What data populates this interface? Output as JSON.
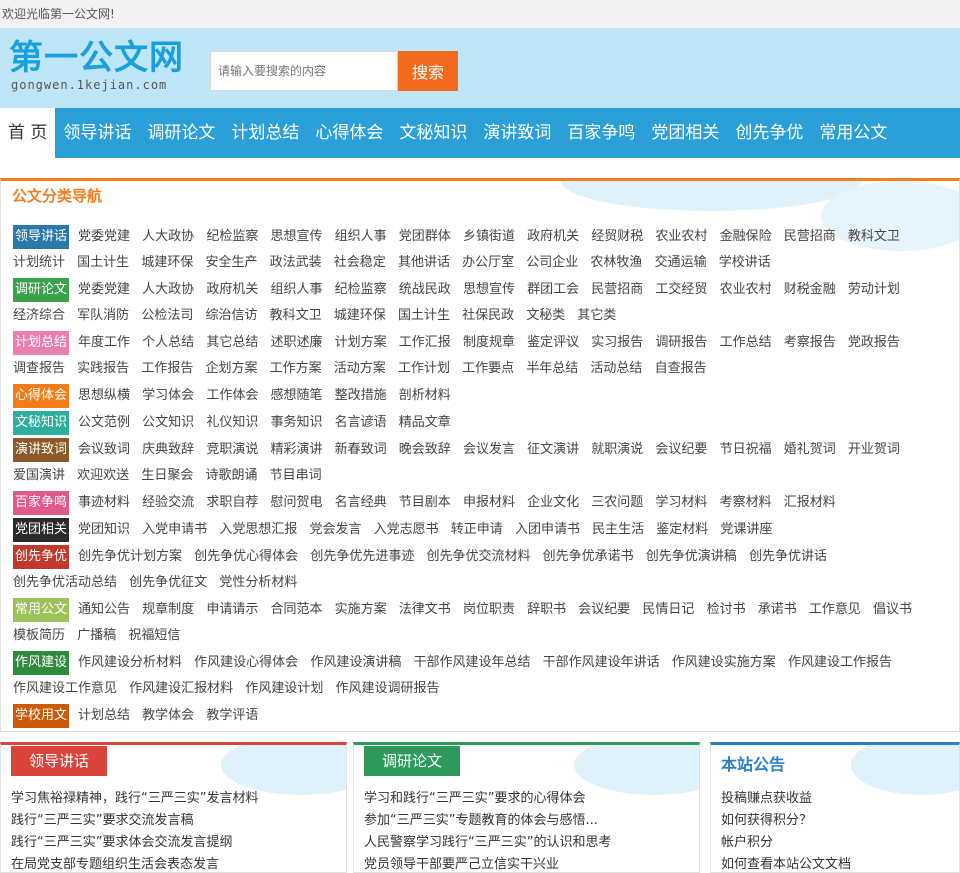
{
  "welcome": "欢迎光临第一公文网!",
  "logo": {
    "main": "第一公文网",
    "sub": "gongwen.1kejian.com"
  },
  "search": {
    "placeholder": "请输入要搜索的内容",
    "button": "搜索"
  },
  "nav": [
    "首 页",
    "领导讲话",
    "调研论文",
    "计划总结",
    "心得体会",
    "文秘知识",
    "演讲致词",
    "百家争鸣",
    "党团相关",
    "创先争优",
    "常用公文"
  ],
  "catnav": {
    "title": "公文分类导航",
    "rows": [
      {
        "tag": "领导讲话",
        "color": "#2a79a8",
        "links": [
          "党委党建",
          "人大政协",
          "纪检监察",
          "思想宣传",
          "组织人事",
          "党团群体",
          "乡镇街道",
          "政府机关",
          "经贸财税",
          "农业农村",
          "金融保险",
          "民营招商",
          "教科文卫",
          "计划统计",
          "国土计生",
          "城建环保",
          "安全生产",
          "政法武装",
          "社会稳定",
          "其他讲话",
          "办公厅室",
          "公司企业",
          "农林牧渔",
          "交通运输",
          "学校讲话"
        ]
      },
      {
        "tag": "调研论文",
        "color": "#3aa24a",
        "links": [
          "党委党建",
          "人大政协",
          "政府机关",
          "组织人事",
          "纪检监察",
          "统战民政",
          "思想宣传",
          "群团工会",
          "民营招商",
          "工交经贸",
          "农业农村",
          "财税金融",
          "劳动计划",
          "经济综合",
          "军队消防",
          "公检法司",
          "综治信访",
          "教科文卫",
          "城建环保",
          "国土计生",
          "社保民政",
          "文秘类",
          "其它类"
        ]
      },
      {
        "tag": "计划总结",
        "color": "#e87fb0",
        "links": [
          "年度工作",
          "个人总结",
          "其它总结",
          "述职述廉",
          "计划方案",
          "工作汇报",
          "制度规章",
          "鉴定评议",
          "实习报告",
          "调研报告",
          "工作总结",
          "考察报告",
          "党政报告",
          "调查报告",
          "实践报告",
          "工作报告",
          "企划方案",
          "工作方案",
          "活动方案",
          "工作计划",
          "工作要点",
          "半年总结",
          "活动总结",
          "自查报告"
        ]
      },
      {
        "tag": "心得体会",
        "color": "#f07d1a",
        "links": [
          "思想纵横",
          "学习体会",
          "工作体会",
          "感想随笔",
          "整改措施",
          "剖析材料"
        ]
      },
      {
        "tag": "文秘知识",
        "color": "#2fae9e",
        "links": [
          "公文范例",
          "公文知识",
          "礼仪知识",
          "事务知识",
          "名言谚语",
          "精品文章"
        ]
      },
      {
        "tag": "演讲致词",
        "color": "#8c5a28",
        "links": [
          "会议致词",
          "庆典致辞",
          "竞职演说",
          "精彩演讲",
          "新春致词",
          "晚会致辞",
          "会议发言",
          "征文演讲",
          "就职演说",
          "会议纪要",
          "节日祝福",
          "婚礼贺词",
          "开业贺词",
          "爱国演讲",
          "欢迎欢送",
          "生日聚会",
          "诗歌朗诵",
          "节目串词"
        ]
      },
      {
        "tag": "百家争鸣",
        "color": "#e05a8c",
        "links": [
          "事迹材料",
          "经验交流",
          "求职自荐",
          "慰问贺电",
          "名言经典",
          "节目剧本",
          "申报材料",
          "企业文化",
          "三农问题",
          "学习材料",
          "考察材料",
          "汇报材料"
        ]
      },
      {
        "tag": "党团相关",
        "color": "#2b2b2b",
        "links": [
          "党团知识",
          "入党申请书",
          "入党思想汇报",
          "党会发言",
          "入党志愿书",
          "转正申请",
          "入团申请书",
          "民主生活",
          "鉴定材料",
          "党课讲座"
        ]
      },
      {
        "tag": "创先争优",
        "color": "#c0392b",
        "links": [
          "创先争优计划方案",
          "创先争优心得体会",
          "创先争优先进事迹",
          "创先争优交流材料",
          "创先争优承诺书",
          "创先争优演讲稿",
          "创先争优讲话",
          "创先争优活动总结",
          "创先争优征文",
          "党性分析材料"
        ]
      },
      {
        "tag": "常用公文",
        "color": "#9dc25a",
        "links": [
          "通知公告",
          "规章制度",
          "申请请示",
          "合同范本",
          "实施方案",
          "法律文书",
          "岗位职责",
          "辞职书",
          "会议纪要",
          "民情日记",
          "检讨书",
          "承诺书",
          "工作意见",
          "倡议书",
          "模板简历",
          "广播稿",
          "祝福短信"
        ]
      },
      {
        "tag": "作风建设",
        "color": "#2e8b3e",
        "links": [
          "作风建设分析材料",
          "作风建设心得体会",
          "作风建设演讲稿",
          "干部作风建设年总结",
          "干部作风建设年讲话",
          "作风建设实施方案",
          "作风建设工作报告",
          "作风建设工作意见",
          "作风建设汇报材料",
          "作风建设计划",
          "作风建设调研报告"
        ]
      },
      {
        "tag": "学校用文",
        "color": "#c85a0a",
        "links": [
          "计划总结",
          "教学体会",
          "教学评语"
        ]
      }
    ]
  },
  "panels": [
    {
      "title": "领导讲话",
      "color": "#d9453a",
      "accent": "#d9453a",
      "items": [
        "学习焦裕禄精神，践行“三严三实”发言材料",
        "践行“三严三实”要求交流发言稿",
        "践行“三严三实”要求体会交流发言提纲",
        "在局党支部专题组织生活会表态发言"
      ]
    },
    {
      "title": "调研论文",
      "color": "#2e9a5c",
      "accent": "#2e9a5c",
      "items": [
        "学习和践行“三严三实”要求的心得体会",
        "参加“三严三实”专题教育的体会与感悟...",
        "人民警察学习践行“三严三实”的认识和思考",
        "党员领导干部要严己立信实干兴业"
      ]
    },
    {
      "title": "本站公告",
      "color": "#2a80c8",
      "accent": "#2a80c8",
      "items": [
        "投稿赚点获收益",
        "如何获得积分？",
        "帐户积分",
        "如何查看本站公文文档"
      ]
    }
  ]
}
